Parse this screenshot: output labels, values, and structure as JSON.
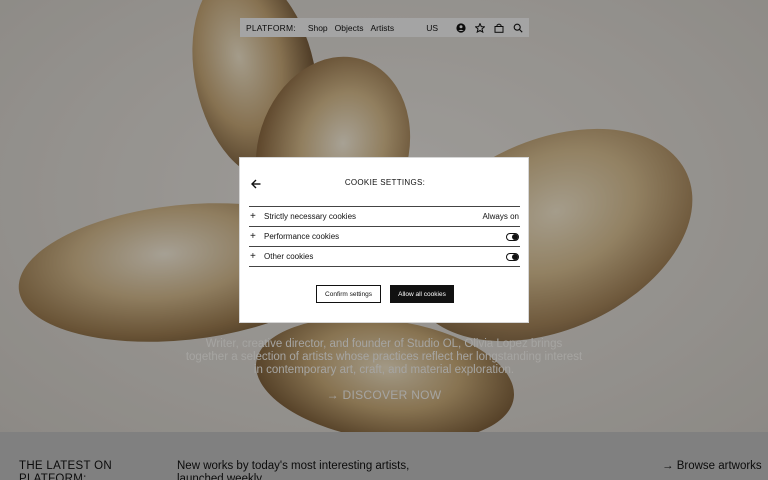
{
  "nav": {
    "brand": "PLATFORM:",
    "links": [
      "Shop",
      "Objects",
      "Artists"
    ],
    "region": "US",
    "icons": [
      "account-icon",
      "favorites-star-icon",
      "cart-bag-icon",
      "search-icon"
    ]
  },
  "hero": {
    "text": "Writer, creative director, and founder of Studio OL, Olivia Lopez brings together a selection of artists whose practices reflect her longstanding interest in contemporary art, craft, and material exploration.",
    "cta": "→ DISCOVER NOW"
  },
  "strip": {
    "latest": "THE LATEST ON PLATFORM:",
    "tagline": "New works by today's most interesting artists, launched weekly",
    "browse": "→ Browse artworks"
  },
  "modal": {
    "title": "COOKIE SETTINGS:",
    "back_icon": "arrow-left-icon",
    "rows": [
      {
        "label": "Strictly necessary cookies",
        "status": "Always on"
      },
      {
        "label": "Performance cookies",
        "enabled": true
      },
      {
        "label": "Other cookies",
        "enabled": true
      }
    ],
    "confirm_label": "Confirm settings",
    "allow_label": "Allow all cookies"
  }
}
